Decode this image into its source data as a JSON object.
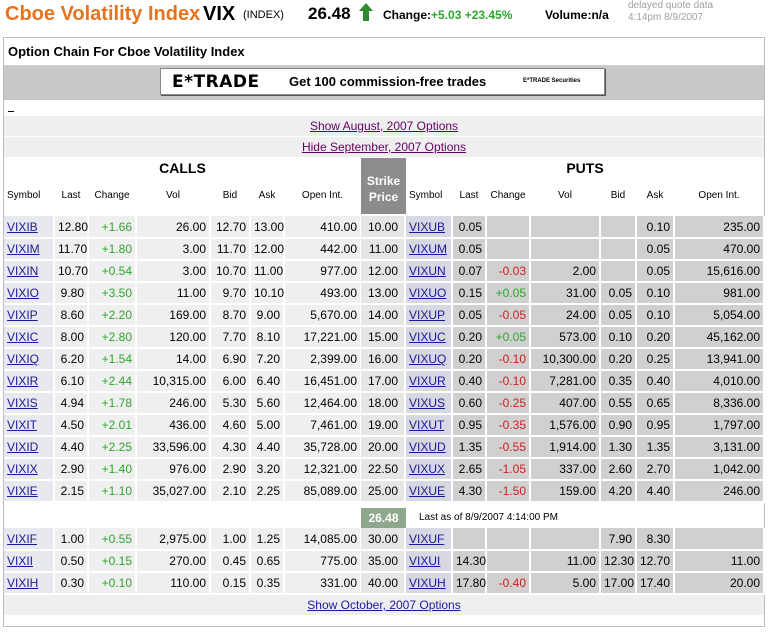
{
  "quote": {
    "title": "Cboe Volatility Index",
    "symbol": "VIX",
    "index_tag": "(INDEX)",
    "price": "26.48",
    "change_label": "Change:",
    "change_value": "+5.03 +23.45%",
    "volume_label": "Volume:",
    "volume_value": "n/a",
    "delayed_line1": "delayed quote data",
    "delayed_line2": "4:14pm 8/9/2007",
    "colors": {
      "title": "#e8731e",
      "up": "#2ea52e",
      "down": "#d02020",
      "link": "#1a1a99"
    },
    "arrow_icon": "green-up-arrow-icon"
  },
  "panel_title": "Option Chain For Cboe Volatility Index",
  "banner": {
    "logo": "E*TRADE",
    "tagline": "Get 100 commission-free trades",
    "small": "E*TRADE Securities"
  },
  "links": {
    "august": "Show August, 2007 Options",
    "september": "Hide September, 2007 Options",
    "october": "Show October, 2007 Options"
  },
  "headers": {
    "calls": "CALLS",
    "puts": "PUTS",
    "strike": "Strike Price",
    "columns": [
      "Symbol",
      "Last",
      "Change",
      "Vol",
      "Bid",
      "Ask",
      "Open Int."
    ]
  },
  "last_box": {
    "price": "26.48",
    "text": "Last as of 8/9/2007 4:14:00 PM"
  },
  "rows_before": [
    {
      "call": [
        "VIXIB",
        "12.80",
        "+1.66",
        "26.00",
        "12.70",
        "13.00",
        "410.00"
      ],
      "strike": "10.00",
      "put": [
        "VIXUB",
        "0.05",
        "",
        "",
        "",
        "0.10",
        "235.00"
      ]
    },
    {
      "call": [
        "VIXIM",
        "11.70",
        "+1.80",
        "3.00",
        "11.70",
        "12.00",
        "442.00"
      ],
      "strike": "11.00",
      "put": [
        "VIXUM",
        "0.05",
        "",
        "",
        "",
        "0.05",
        "470.00"
      ]
    },
    {
      "call": [
        "VIXIN",
        "10.70",
        "+0.54",
        "3.00",
        "10.70",
        "11.00",
        "977.00"
      ],
      "strike": "12.00",
      "put": [
        "VIXUN",
        "0.07",
        "-0.03",
        "2.00",
        "",
        "0.05",
        "15,616.00"
      ]
    },
    {
      "call": [
        "VIXIO",
        "9.80",
        "+3.50",
        "11.00",
        "9.70",
        "10.10",
        "493.00"
      ],
      "strike": "13.00",
      "put": [
        "VIXUO",
        "0.15",
        "+0.05",
        "31.00",
        "0.05",
        "0.10",
        "981.00"
      ]
    },
    {
      "call": [
        "VIXIP",
        "8.60",
        "+2.20",
        "169.00",
        "8.70",
        "9.00",
        "5,670.00"
      ],
      "strike": "14.00",
      "put": [
        "VIXUP",
        "0.05",
        "-0.05",
        "24.00",
        "0.05",
        "0.10",
        "5,054.00"
      ]
    },
    {
      "call": [
        "VIXIC",
        "8.00",
        "+2.80",
        "120.00",
        "7.70",
        "8.10",
        "17,221.00"
      ],
      "strike": "15.00",
      "put": [
        "VIXUC",
        "0.20",
        "+0.05",
        "573.00",
        "0.10",
        "0.20",
        "45,162.00"
      ]
    },
    {
      "call": [
        "VIXIQ",
        "6.20",
        "+1.54",
        "14.00",
        "6.90",
        "7.20",
        "2,399.00"
      ],
      "strike": "16.00",
      "put": [
        "VIXUQ",
        "0.20",
        "-0.10",
        "10,300.00",
        "0.20",
        "0.25",
        "13,941.00"
      ]
    },
    {
      "call": [
        "VIXIR",
        "6.10",
        "+2.44",
        "10,315.00",
        "6.00",
        "6.40",
        "16,451.00"
      ],
      "strike": "17.00",
      "put": [
        "VIXUR",
        "0.40",
        "-0.10",
        "7,281.00",
        "0.35",
        "0.40",
        "4,010.00"
      ]
    },
    {
      "call": [
        "VIXIS",
        "4.94",
        "+1.78",
        "246.00",
        "5.30",
        "5.60",
        "12,464.00"
      ],
      "strike": "18.00",
      "put": [
        "VIXUS",
        "0.60",
        "-0.25",
        "407.00",
        "0.55",
        "0.65",
        "8,336.00"
      ]
    },
    {
      "call": [
        "VIXIT",
        "4.50",
        "+2.01",
        "436.00",
        "4.60",
        "5.00",
        "7,461.00"
      ],
      "strike": "19.00",
      "put": [
        "VIXUT",
        "0.95",
        "-0.35",
        "1,576.00",
        "0.90",
        "0.95",
        "1,797.00"
      ]
    },
    {
      "call": [
        "VIXID",
        "4.40",
        "+2.25",
        "33,596.00",
        "4.30",
        "4.40",
        "35,728.00"
      ],
      "strike": "20.00",
      "put": [
        "VIXUD",
        "1.35",
        "-0.55",
        "1,914.00",
        "1.30",
        "1.35",
        "3,131.00"
      ]
    },
    {
      "call": [
        "VIXIX",
        "2.90",
        "+1.40",
        "976.00",
        "2.90",
        "3.20",
        "12,321.00"
      ],
      "strike": "22.50",
      "put": [
        "VIXUX",
        "2.65",
        "-1.05",
        "337.00",
        "2.60",
        "2.70",
        "1,042.00"
      ]
    },
    {
      "call": [
        "VIXIE",
        "2.15",
        "+1.10",
        "35,027.00",
        "2.10",
        "2.25",
        "85,089.00"
      ],
      "strike": "25.00",
      "put": [
        "VIXUE",
        "4.30",
        "-1.50",
        "159.00",
        "4.20",
        "4.40",
        "246.00"
      ]
    }
  ],
  "rows_after": [
    {
      "call": [
        "VIXIF",
        "1.00",
        "+0.55",
        "2,975.00",
        "1.00",
        "1.25",
        "14,085.00"
      ],
      "strike": "30.00",
      "put": [
        "VIXUF",
        "",
        "",
        "",
        "7.90",
        "8.30",
        ""
      ]
    },
    {
      "call": [
        "VIXII",
        "0.50",
        "+0.15",
        "270.00",
        "0.45",
        "0.65",
        "775.00"
      ],
      "strike": "35.00",
      "put": [
        "VIXUI",
        "14.30",
        "",
        "11.00",
        "12.30",
        "12.70",
        "11.00"
      ]
    },
    {
      "call": [
        "VIXIH",
        "0.30",
        "+0.10",
        "110.00",
        "0.15",
        "0.35",
        "331.00"
      ],
      "strike": "40.00",
      "put": [
        "VIXUH",
        "17.80",
        "-0.40",
        "5.00",
        "17.00",
        "17.40",
        "20.00"
      ]
    }
  ]
}
